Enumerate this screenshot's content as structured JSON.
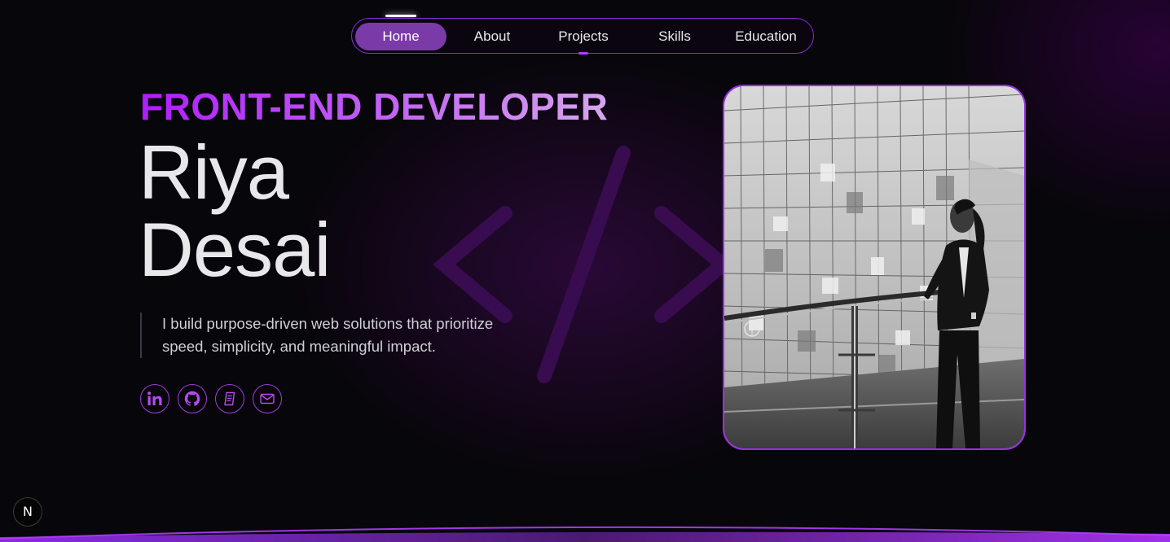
{
  "nav": {
    "items": [
      {
        "label": "Home",
        "active": true
      },
      {
        "label": "About"
      },
      {
        "label": "Projects"
      },
      {
        "label": "Skills"
      },
      {
        "label": "Education"
      }
    ]
  },
  "hero": {
    "role": "FRONT-END DEVELOPER",
    "first_name": "Riya",
    "last_name": "Desai",
    "tagline_line1": "I build purpose-driven web solutions that prioritize",
    "tagline_line2": "speed, simplicity, and meaningful impact."
  },
  "social": [
    {
      "icon": "linkedin-icon"
    },
    {
      "icon": "github-icon"
    },
    {
      "icon": "resume-icon"
    },
    {
      "icon": "mail-icon"
    }
  ],
  "badge": {
    "label": "N"
  },
  "colors": {
    "accent": "#9b2ee6",
    "nav_active": "#7a3aa8",
    "background": "#07060a"
  }
}
